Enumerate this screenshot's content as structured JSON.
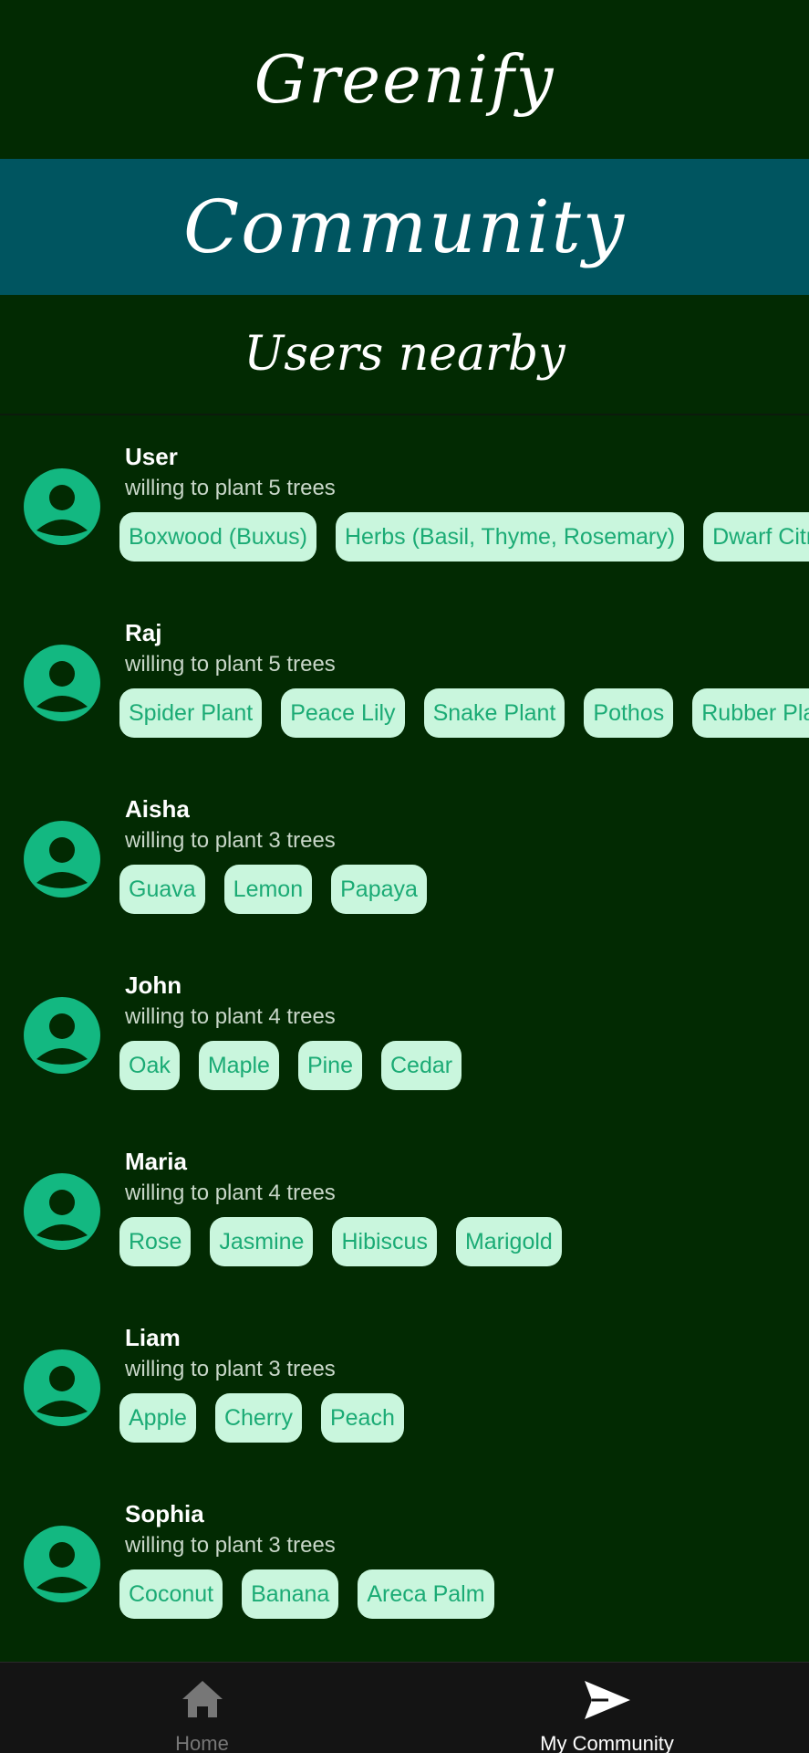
{
  "app": {
    "title": "Greenify"
  },
  "banner": {
    "title": "Community"
  },
  "section": {
    "title": "Users nearby"
  },
  "users": [
    {
      "name": "User",
      "pledge": "willing to plant 5 trees",
      "plants": [
        "Boxwood (Buxus)",
        "Herbs (Basil, Thyme, Rosemary)",
        "Dwarf Citrus"
      ]
    },
    {
      "name": "Raj",
      "pledge": "willing to plant 5 trees",
      "plants": [
        "Spider Plant",
        "Peace Lily",
        "Snake Plant",
        "Pothos",
        "Rubber Plant"
      ]
    },
    {
      "name": "Aisha",
      "pledge": "willing to plant 3 trees",
      "plants": [
        "Guava",
        "Lemon",
        "Papaya"
      ]
    },
    {
      "name": "John",
      "pledge": "willing to plant 4 trees",
      "plants": [
        "Oak",
        "Maple",
        "Pine",
        "Cedar"
      ]
    },
    {
      "name": "Maria",
      "pledge": "willing to plant 4 trees",
      "plants": [
        "Rose",
        "Jasmine",
        "Hibiscus",
        "Marigold"
      ]
    },
    {
      "name": "Liam",
      "pledge": "willing to plant 3 trees",
      "plants": [
        "Apple",
        "Cherry",
        "Peach"
      ]
    },
    {
      "name": "Sophia",
      "pledge": "willing to plant 3 trees",
      "plants": [
        "Coconut",
        "Banana",
        "Areca Palm"
      ]
    }
  ],
  "nav": {
    "items": [
      {
        "label": "Home",
        "icon": "home-icon",
        "active": false
      },
      {
        "label": "My Community",
        "icon": "send-icon",
        "active": true
      }
    ]
  },
  "colors": {
    "background": "#022a02",
    "banner": "#005560",
    "avatar": "#13b881",
    "chip_bg": "#c9f6dd",
    "chip_text": "#1bab75",
    "nav_bg": "#141414"
  }
}
